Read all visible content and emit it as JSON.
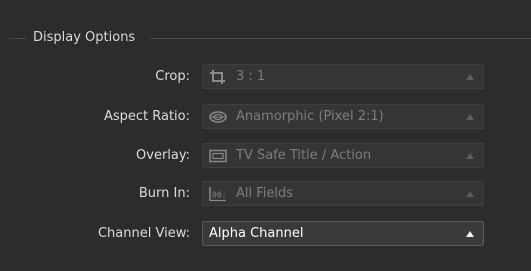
{
  "group": {
    "title": "Display Options"
  },
  "rows": [
    {
      "label": "Crop:",
      "value": "3 : 1",
      "icon": "crop-icon",
      "enabled": false
    },
    {
      "label": "Aspect Ratio:",
      "value": "Anamorphic (Pixel 2:1)",
      "icon": "anamorphic-lens-icon",
      "enabled": false
    },
    {
      "label": "Overlay:",
      "value": "TV Safe Title / Action",
      "icon": "safe-area-overlay-icon",
      "enabled": false
    },
    {
      "label": "Burn In:",
      "value": "All Fields",
      "icon": "timecode-burn-in-icon",
      "icon_text": "00:",
      "enabled": false
    },
    {
      "label": "Channel View:",
      "value": "Alpha Channel",
      "icon": "",
      "enabled": true
    }
  ],
  "colors": {
    "background": "#2c2c2c",
    "disabled_text": "#7d7d7d",
    "active_text": "#ffffff"
  }
}
